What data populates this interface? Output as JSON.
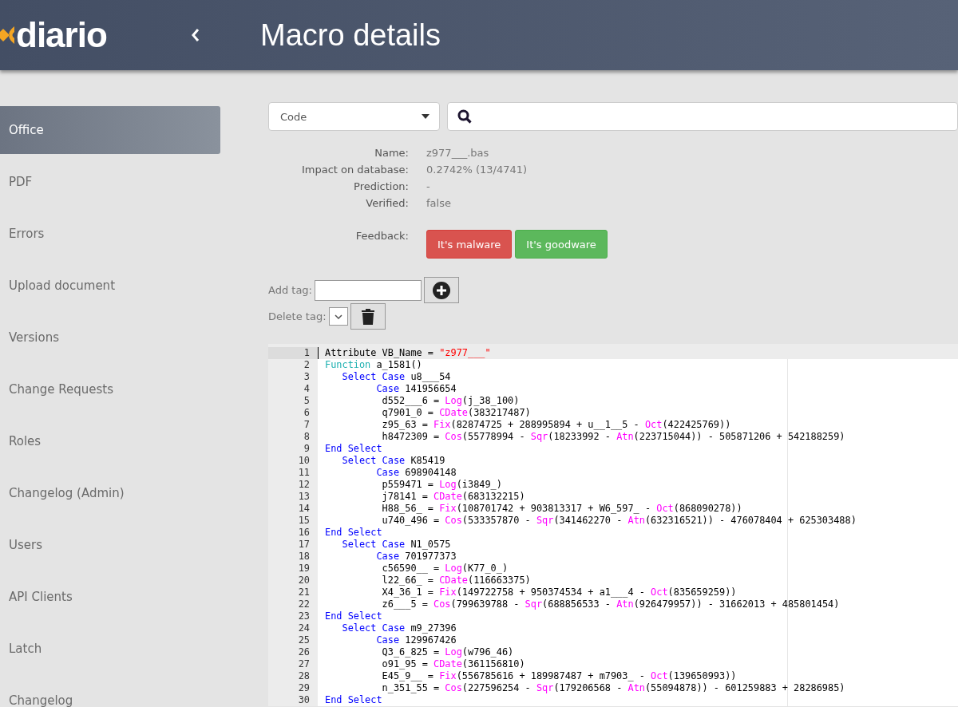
{
  "header": {
    "logo": "diario",
    "title": "Macro details"
  },
  "sidebar": {
    "items": [
      {
        "label": "Office",
        "selected": true
      },
      {
        "label": "PDF",
        "selected": false
      },
      {
        "label": "Errors",
        "selected": false
      },
      {
        "label": "Upload document",
        "selected": false
      },
      {
        "label": "Versions",
        "selected": false
      },
      {
        "label": "Change Requests",
        "selected": false
      },
      {
        "label": "Roles",
        "selected": false
      },
      {
        "label": "Changelog (Admin)",
        "selected": false
      },
      {
        "label": "Users",
        "selected": false
      },
      {
        "label": "API Clients",
        "selected": false
      },
      {
        "label": "Latch",
        "selected": false
      },
      {
        "label": "Changelog",
        "selected": false
      }
    ]
  },
  "view_select": {
    "value": "Code"
  },
  "details": [
    {
      "label": "Name:",
      "value": "z977___.bas"
    },
    {
      "label": "Impact on database:",
      "value": "0.2742% (13/4741)"
    },
    {
      "label": "Prediction:",
      "value": "-"
    },
    {
      "label": "Verified:",
      "value": "false"
    }
  ],
  "feedback": {
    "label": "Feedback:",
    "buttons": [
      {
        "label": "It's malware",
        "kind": "malware"
      },
      {
        "label": "It's goodware",
        "kind": "goodware"
      }
    ]
  },
  "tags": {
    "add_label": "Add tag:",
    "delete_label": "Delete tag:"
  },
  "code": {
    "lines": [
      {
        "number": "1",
        "current": true,
        "tokens": [
          {
            "kind": "text",
            "text": "Attribute VB_Name = "
          },
          {
            "kind": "string",
            "text": "\"z977___\""
          }
        ]
      },
      {
        "number": "2",
        "current": false,
        "tokens": [
          {
            "kind": "declaration",
            "text": "Function"
          },
          {
            "kind": "text",
            "text": " a_1581()"
          }
        ]
      },
      {
        "number": "3",
        "current": false,
        "tokens": [
          {
            "kind": "keyword",
            "text": "   Select Case"
          },
          {
            "kind": "text",
            "text": " u8___54"
          }
        ]
      },
      {
        "number": "4",
        "current": false,
        "tokens": [
          {
            "kind": "keyword",
            "text": "         Case"
          },
          {
            "kind": "text",
            "text": " 141956654"
          }
        ]
      },
      {
        "number": "5",
        "current": false,
        "tokens": [
          {
            "kind": "text",
            "text": "          d552___6 = "
          },
          {
            "kind": "function",
            "text": "Log"
          },
          {
            "kind": "text",
            "text": "(j_38_100)"
          }
        ]
      },
      {
        "number": "6",
        "current": false,
        "tokens": [
          {
            "kind": "text",
            "text": "          q7901_0 = "
          },
          {
            "kind": "function",
            "text": "CDate"
          },
          {
            "kind": "text",
            "text": "(383217487)"
          }
        ]
      },
      {
        "number": "7",
        "current": false,
        "tokens": [
          {
            "kind": "text",
            "text": "          z95_63 = "
          },
          {
            "kind": "function",
            "text": "Fix"
          },
          {
            "kind": "text",
            "text": "(82874725 + 288995894 + u__1__5 - "
          },
          {
            "kind": "function",
            "text": "Oct"
          },
          {
            "kind": "text",
            "text": "(422425769))"
          }
        ]
      },
      {
        "number": "8",
        "current": false,
        "tokens": [
          {
            "kind": "text",
            "text": "          h8472309 = "
          },
          {
            "kind": "function",
            "text": "Cos"
          },
          {
            "kind": "text",
            "text": "(55778994 - "
          },
          {
            "kind": "function",
            "text": "Sqr"
          },
          {
            "kind": "text",
            "text": "(18233992 - "
          },
          {
            "kind": "function",
            "text": "Atn"
          },
          {
            "kind": "text",
            "text": "(223715044)) - 505871206 + 542188259)"
          }
        ]
      },
      {
        "number": "9",
        "current": false,
        "tokens": [
          {
            "kind": "keyword",
            "text": "End Select"
          }
        ]
      },
      {
        "number": "10",
        "current": false,
        "tokens": [
          {
            "kind": "keyword",
            "text": "   Select Case"
          },
          {
            "kind": "text",
            "text": " K85419"
          }
        ]
      },
      {
        "number": "11",
        "current": false,
        "tokens": [
          {
            "kind": "keyword",
            "text": "         Case"
          },
          {
            "kind": "text",
            "text": " 698904148"
          }
        ]
      },
      {
        "number": "12",
        "current": false,
        "tokens": [
          {
            "kind": "text",
            "text": "          p559471 = "
          },
          {
            "kind": "function",
            "text": "Log"
          },
          {
            "kind": "text",
            "text": "(i3849_)"
          }
        ]
      },
      {
        "number": "13",
        "current": false,
        "tokens": [
          {
            "kind": "text",
            "text": "          j78141 = "
          },
          {
            "kind": "function",
            "text": "CDate"
          },
          {
            "kind": "text",
            "text": "(683132215)"
          }
        ]
      },
      {
        "number": "14",
        "current": false,
        "tokens": [
          {
            "kind": "text",
            "text": "          H88_56_ = "
          },
          {
            "kind": "function",
            "text": "Fix"
          },
          {
            "kind": "text",
            "text": "(108701742 + 903813317 + W6_597_ - "
          },
          {
            "kind": "function",
            "text": "Oct"
          },
          {
            "kind": "text",
            "text": "(868090278))"
          }
        ]
      },
      {
        "number": "15",
        "current": false,
        "tokens": [
          {
            "kind": "text",
            "text": "          u740_496 = "
          },
          {
            "kind": "function",
            "text": "Cos"
          },
          {
            "kind": "text",
            "text": "(533357870 - "
          },
          {
            "kind": "function",
            "text": "Sqr"
          },
          {
            "kind": "text",
            "text": "(341462270 - "
          },
          {
            "kind": "function",
            "text": "Atn"
          },
          {
            "kind": "text",
            "text": "(632316521)) - 476078404 + 625303488)"
          }
        ]
      },
      {
        "number": "16",
        "current": false,
        "tokens": [
          {
            "kind": "keyword",
            "text": "End Select"
          }
        ]
      },
      {
        "number": "17",
        "current": false,
        "tokens": [
          {
            "kind": "keyword",
            "text": "   Select Case"
          },
          {
            "kind": "text",
            "text": " N1_0575"
          }
        ]
      },
      {
        "number": "18",
        "current": false,
        "tokens": [
          {
            "kind": "keyword",
            "text": "         Case"
          },
          {
            "kind": "text",
            "text": " 701977373"
          }
        ]
      },
      {
        "number": "19",
        "current": false,
        "tokens": [
          {
            "kind": "text",
            "text": "          c56590__ = "
          },
          {
            "kind": "function",
            "text": "Log"
          },
          {
            "kind": "text",
            "text": "(K77_0_)"
          }
        ]
      },
      {
        "number": "20",
        "current": false,
        "tokens": [
          {
            "kind": "text",
            "text": "          l22_66_ = "
          },
          {
            "kind": "function",
            "text": "CDate"
          },
          {
            "kind": "text",
            "text": "(116663375)"
          }
        ]
      },
      {
        "number": "21",
        "current": false,
        "tokens": [
          {
            "kind": "text",
            "text": "          X4_36_1 = "
          },
          {
            "kind": "function",
            "text": "Fix"
          },
          {
            "kind": "text",
            "text": "(149722758 + 950374534 + a1___4 - "
          },
          {
            "kind": "function",
            "text": "Oct"
          },
          {
            "kind": "text",
            "text": "(835659259))"
          }
        ]
      },
      {
        "number": "22",
        "current": false,
        "tokens": [
          {
            "kind": "text",
            "text": "          z6___5 = "
          },
          {
            "kind": "function",
            "text": "Cos"
          },
          {
            "kind": "text",
            "text": "(799639788 - "
          },
          {
            "kind": "function",
            "text": "Sqr"
          },
          {
            "kind": "text",
            "text": "(688856533 - "
          },
          {
            "kind": "function",
            "text": "Atn"
          },
          {
            "kind": "text",
            "text": "(926479957)) - 31662013 + 485801454)"
          }
        ]
      },
      {
        "number": "23",
        "current": false,
        "tokens": [
          {
            "kind": "keyword",
            "text": "End Select"
          }
        ]
      },
      {
        "number": "24",
        "current": false,
        "tokens": [
          {
            "kind": "keyword",
            "text": "   Select Case"
          },
          {
            "kind": "text",
            "text": " m9_27396"
          }
        ]
      },
      {
        "number": "25",
        "current": false,
        "tokens": [
          {
            "kind": "keyword",
            "text": "         Case"
          },
          {
            "kind": "text",
            "text": " 129967426"
          }
        ]
      },
      {
        "number": "26",
        "current": false,
        "tokens": [
          {
            "kind": "text",
            "text": "          Q3_6_825 = "
          },
          {
            "kind": "function",
            "text": "Log"
          },
          {
            "kind": "text",
            "text": "(w796_46)"
          }
        ]
      },
      {
        "number": "27",
        "current": false,
        "tokens": [
          {
            "kind": "text",
            "text": "          o91_95 = "
          },
          {
            "kind": "function",
            "text": "CDate"
          },
          {
            "kind": "text",
            "text": "(361156810)"
          }
        ]
      },
      {
        "number": "28",
        "current": false,
        "tokens": [
          {
            "kind": "text",
            "text": "          E45_9__ = "
          },
          {
            "kind": "function",
            "text": "Fix"
          },
          {
            "kind": "text",
            "text": "(556785616 + 189987487 + m7903_ - "
          },
          {
            "kind": "function",
            "text": "Oct"
          },
          {
            "kind": "text",
            "text": "(139650993))"
          }
        ]
      },
      {
        "number": "29",
        "current": false,
        "tokens": [
          {
            "kind": "text",
            "text": "          n_351_55 = "
          },
          {
            "kind": "function",
            "text": "Cos"
          },
          {
            "kind": "text",
            "text": "(227596254 - "
          },
          {
            "kind": "function",
            "text": "Sqr"
          },
          {
            "kind": "text",
            "text": "(179206568 - "
          },
          {
            "kind": "function",
            "text": "Atn"
          },
          {
            "kind": "text",
            "text": "(55094878)) - 601259883 + 28286985)"
          }
        ]
      },
      {
        "number": "30",
        "current": false,
        "tokens": [
          {
            "kind": "keyword",
            "text": "End Select"
          }
        ]
      }
    ]
  }
}
